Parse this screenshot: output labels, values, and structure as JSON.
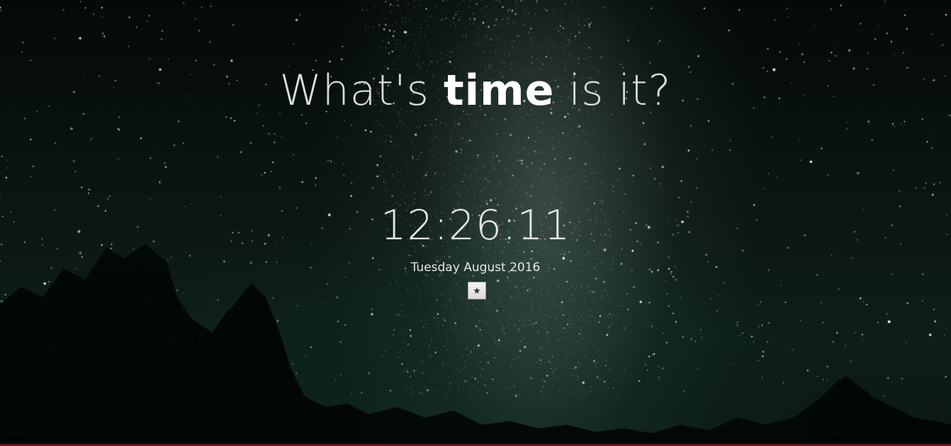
{
  "headline": {
    "before": "What's ",
    "emphasis": "time",
    "after": " is it?"
  },
  "clock": {
    "time": "12:26:11",
    "date": "Tuesday August 2016"
  },
  "favorite_button": {
    "icon": "star-icon",
    "glyph": "★"
  },
  "colors": {
    "text": "#e4e8e6",
    "accent_bar": "#6a1414"
  }
}
